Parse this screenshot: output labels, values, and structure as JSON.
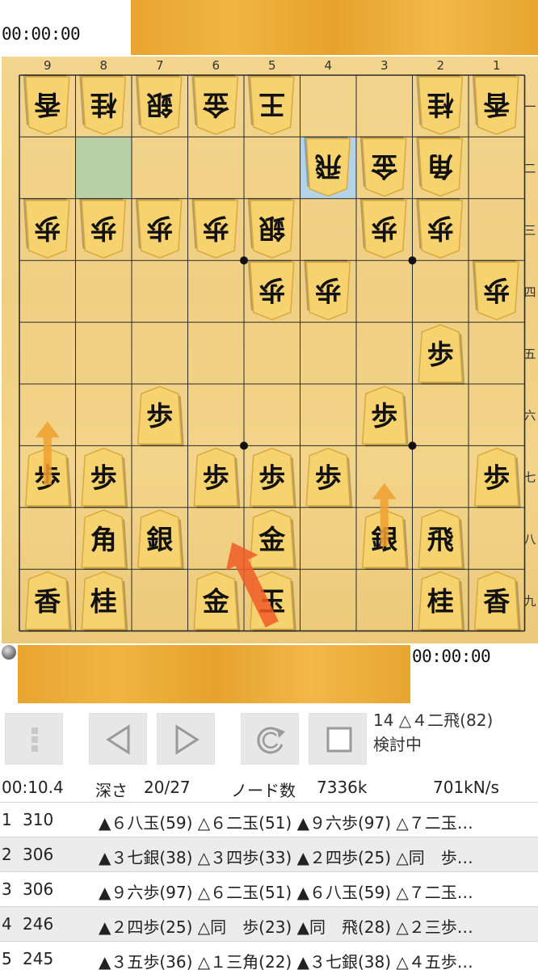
{
  "clocks": {
    "top": "00:00:00",
    "bottom": "00:00:00"
  },
  "board": {
    "file_labels": [
      "9",
      "8",
      "7",
      "6",
      "5",
      "4",
      "3",
      "2",
      "1"
    ],
    "rank_labels": [
      "一",
      "二",
      "三",
      "四",
      "五",
      "六",
      "七",
      "八",
      "九"
    ],
    "highlight_from": {
      "file": 8,
      "rank": 2
    },
    "highlight_to": {
      "file": 4,
      "rank": 2
    },
    "star_points": [
      [
        6,
        3
      ],
      [
        3,
        3
      ],
      [
        6,
        6
      ],
      [
        3,
        6
      ]
    ],
    "pieces": [
      {
        "file": 9,
        "rank": 1,
        "kanji": "香",
        "side": "gote"
      },
      {
        "file": 8,
        "rank": 1,
        "kanji": "桂",
        "side": "gote"
      },
      {
        "file": 7,
        "rank": 1,
        "kanji": "銀",
        "side": "gote"
      },
      {
        "file": 6,
        "rank": 1,
        "kanji": "金",
        "side": "gote"
      },
      {
        "file": 5,
        "rank": 1,
        "kanji": "王",
        "side": "gote"
      },
      {
        "file": 2,
        "rank": 1,
        "kanji": "桂",
        "side": "gote"
      },
      {
        "file": 1,
        "rank": 1,
        "kanji": "香",
        "side": "gote"
      },
      {
        "file": 4,
        "rank": 2,
        "kanji": "飛",
        "side": "gote"
      },
      {
        "file": 3,
        "rank": 2,
        "kanji": "金",
        "side": "gote"
      },
      {
        "file": 2,
        "rank": 2,
        "kanji": "角",
        "side": "gote"
      },
      {
        "file": 9,
        "rank": 3,
        "kanji": "歩",
        "side": "gote"
      },
      {
        "file": 8,
        "rank": 3,
        "kanji": "歩",
        "side": "gote"
      },
      {
        "file": 7,
        "rank": 3,
        "kanji": "歩",
        "side": "gote"
      },
      {
        "file": 6,
        "rank": 3,
        "kanji": "歩",
        "side": "gote"
      },
      {
        "file": 5,
        "rank": 3,
        "kanji": "銀",
        "side": "gote"
      },
      {
        "file": 3,
        "rank": 3,
        "kanji": "歩",
        "side": "gote"
      },
      {
        "file": 2,
        "rank": 3,
        "kanji": "歩",
        "side": "gote"
      },
      {
        "file": 5,
        "rank": 4,
        "kanji": "歩",
        "side": "gote"
      },
      {
        "file": 4,
        "rank": 4,
        "kanji": "歩",
        "side": "gote"
      },
      {
        "file": 1,
        "rank": 4,
        "kanji": "歩",
        "side": "gote"
      },
      {
        "file": 2,
        "rank": 5,
        "kanji": "歩",
        "side": "sente"
      },
      {
        "file": 7,
        "rank": 6,
        "kanji": "歩",
        "side": "sente"
      },
      {
        "file": 3,
        "rank": 6,
        "kanji": "歩",
        "side": "sente"
      },
      {
        "file": 9,
        "rank": 7,
        "kanji": "歩",
        "side": "sente"
      },
      {
        "file": 8,
        "rank": 7,
        "kanji": "歩",
        "side": "sente"
      },
      {
        "file": 6,
        "rank": 7,
        "kanji": "歩",
        "side": "sente"
      },
      {
        "file": 5,
        "rank": 7,
        "kanji": "歩",
        "side": "sente"
      },
      {
        "file": 4,
        "rank": 7,
        "kanji": "歩",
        "side": "sente"
      },
      {
        "file": 1,
        "rank": 7,
        "kanji": "歩",
        "side": "sente"
      },
      {
        "file": 8,
        "rank": 8,
        "kanji": "角",
        "side": "sente"
      },
      {
        "file": 7,
        "rank": 8,
        "kanji": "銀",
        "side": "sente"
      },
      {
        "file": 5,
        "rank": 8,
        "kanji": "金",
        "side": "sente"
      },
      {
        "file": 3,
        "rank": 8,
        "kanji": "銀",
        "side": "sente"
      },
      {
        "file": 2,
        "rank": 8,
        "kanji": "飛",
        "side": "sente"
      },
      {
        "file": 9,
        "rank": 9,
        "kanji": "香",
        "side": "sente"
      },
      {
        "file": 8,
        "rank": 9,
        "kanji": "桂",
        "side": "sente"
      },
      {
        "file": 6,
        "rank": 9,
        "kanji": "金",
        "side": "sente"
      },
      {
        "file": 5,
        "rank": 9,
        "kanji": "玉",
        "side": "sente"
      },
      {
        "file": 2,
        "rank": 9,
        "kanji": "桂",
        "side": "sente"
      },
      {
        "file": 1,
        "rank": 9,
        "kanji": "香",
        "side": "sente"
      }
    ],
    "arrows": [
      {
        "from": [
          9,
          7
        ],
        "to": [
          9,
          6
        ],
        "color": "#f0a030",
        "role": "hint"
      },
      {
        "from": [
          3,
          8
        ],
        "to": [
          3,
          7
        ],
        "color": "#f0a030",
        "role": "hint"
      },
      {
        "from": [
          5,
          9
        ],
        "to": [
          6,
          8
        ],
        "color": "#f05a28",
        "role": "best"
      }
    ]
  },
  "controls": {
    "buttons": [
      {
        "name": "menu-button",
        "icon": "vertical-dots-icon"
      },
      {
        "name": "previous-move-button",
        "icon": "triangle-left-icon"
      },
      {
        "name": "next-move-button",
        "icon": "triangle-right-icon"
      },
      {
        "name": "refresh-analysis-button",
        "icon": "refresh-icon"
      },
      {
        "name": "stop-button",
        "icon": "square-icon"
      }
    ],
    "last_move": "14 △４二飛(82)",
    "status": "検討中"
  },
  "stats": {
    "time": "00:10.4",
    "depth_label": "深さ",
    "depth_value": "20/27",
    "nodes_label": "ノード数",
    "nodes_value": "7336k",
    "nps": "701kN/s"
  },
  "pv": [
    {
      "index": "1",
      "score": "310",
      "moves": "▲６八玉(59) △６二玉(51) ▲９六歩(97) △７二玉…"
    },
    {
      "index": "2",
      "score": "306",
      "moves": "▲３七銀(38) △３四歩(33) ▲２四歩(25) △同　歩…"
    },
    {
      "index": "3",
      "score": "306",
      "moves": "▲９六歩(97) △６二玉(51) ▲６八玉(59) △７二玉…"
    },
    {
      "index": "4",
      "score": "246",
      "moves": "▲２四歩(25) △同　歩(23) ▲同　飛(28) △２三歩…"
    },
    {
      "index": "5",
      "score": "245",
      "moves": "▲３五歩(36) △１三角(22) ▲３七銀(38) △４五歩…"
    }
  ],
  "colors": {
    "highlight_from": "#b9cfa6",
    "highlight_to": "#b3d3e8",
    "piece_fill": "#f7d36f",
    "piece_edge": "#d9a93c",
    "grid": "#2b2b2b"
  }
}
